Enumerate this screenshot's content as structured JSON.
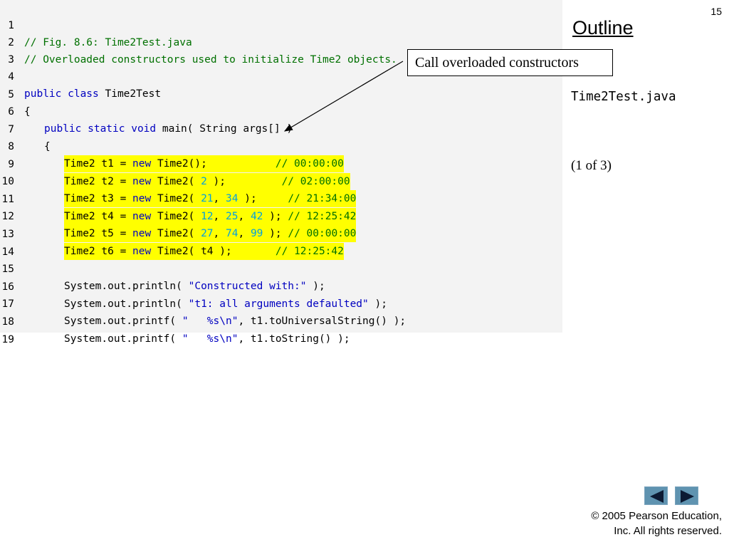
{
  "slide": {
    "page_number": "15",
    "outline_label": "Outline",
    "file_title": "Time2Test.java",
    "part_label": "(1 of  3)",
    "callout_text": "Call overloaded constructors",
    "copyright_line1": "© 2005 Pearson Education,",
    "copyright_line2": "Inc.  All rights reserved."
  },
  "code": {
    "line_numbers": [
      "1",
      "2",
      "3",
      "4",
      "5",
      "6",
      "7",
      "8",
      "9",
      "10",
      "11",
      "12",
      "13",
      "14",
      "15",
      "16",
      "17",
      "18",
      "19"
    ],
    "l1": "// Fig. 8.6: Time2Test.java",
    "l2": "// Overloaded constructors used to initialize Time2 objects.",
    "l4_kw": "public class",
    "l4_rest": " Time2Test",
    "l5": "{",
    "l6_kw": "public static void",
    "l6_rest": " main( String args[] )",
    "l7": "{",
    "l8_a": "Time2 t1 = ",
    "l8_new": "new",
    "l8_b": " Time2();           ",
    "l8_cm": "// 00:00:00",
    "l9_a": "Time2 t2 = ",
    "l9_new": "new",
    "l9_b": " Time2( ",
    "l9_n1": "2",
    "l9_c": " );         ",
    "l9_cm": "// 02:00:00",
    "l10_a": "Time2 t3 = ",
    "l10_new": "new",
    "l10_b": " Time2( ",
    "l10_n1": "21",
    "l10_c": ", ",
    "l10_n2": "34",
    "l10_d": " );     ",
    "l10_cm": "// 21:34:00",
    "l11_a": "Time2 t4 = ",
    "l11_new": "new",
    "l11_b": " Time2( ",
    "l11_n1": "12",
    "l11_c": ", ",
    "l11_n2": "25",
    "l11_d": ", ",
    "l11_n3": "42",
    "l11_e": " ); ",
    "l11_cm": "// 12:25:42",
    "l12_a": "Time2 t5 = ",
    "l12_new": "new",
    "l12_b": " Time2( ",
    "l12_n1": "27",
    "l12_c": ", ",
    "l12_n2": "74",
    "l12_d": ", ",
    "l12_n3": "99",
    "l12_e": " ); ",
    "l12_cm": "// 00:00:00",
    "l13_a": "Time2 t6 = ",
    "l13_new": "new",
    "l13_b": " Time2( t4 );       ",
    "l13_cm": "// 12:25:42",
    "l15_a": "System.out.println( ",
    "l15_str": "\"Constructed with:\"",
    "l15_b": " );",
    "l16_a": "System.out.println( ",
    "l16_str": "\"t1: all arguments defaulted\"",
    "l16_b": " );",
    "l17_a": "System.out.printf( ",
    "l17_str": "\"   %s\\n\"",
    "l17_b": ", t1.toUniversalString() );",
    "l18_a": "System.out.printf( ",
    "l18_str": "\"   %s\\n\"",
    "l18_b": ", t1.toString() );"
  },
  "navigation": {
    "prev_icon": "triangle-left-icon",
    "next_icon": "triangle-right-icon"
  },
  "colors": {
    "code_background": "#f3f3f3",
    "highlight": "#ffff00",
    "keyword": "#0000c0",
    "comment": "#007000",
    "number": "#00a0e0",
    "nav_button": "#5f93b0"
  }
}
